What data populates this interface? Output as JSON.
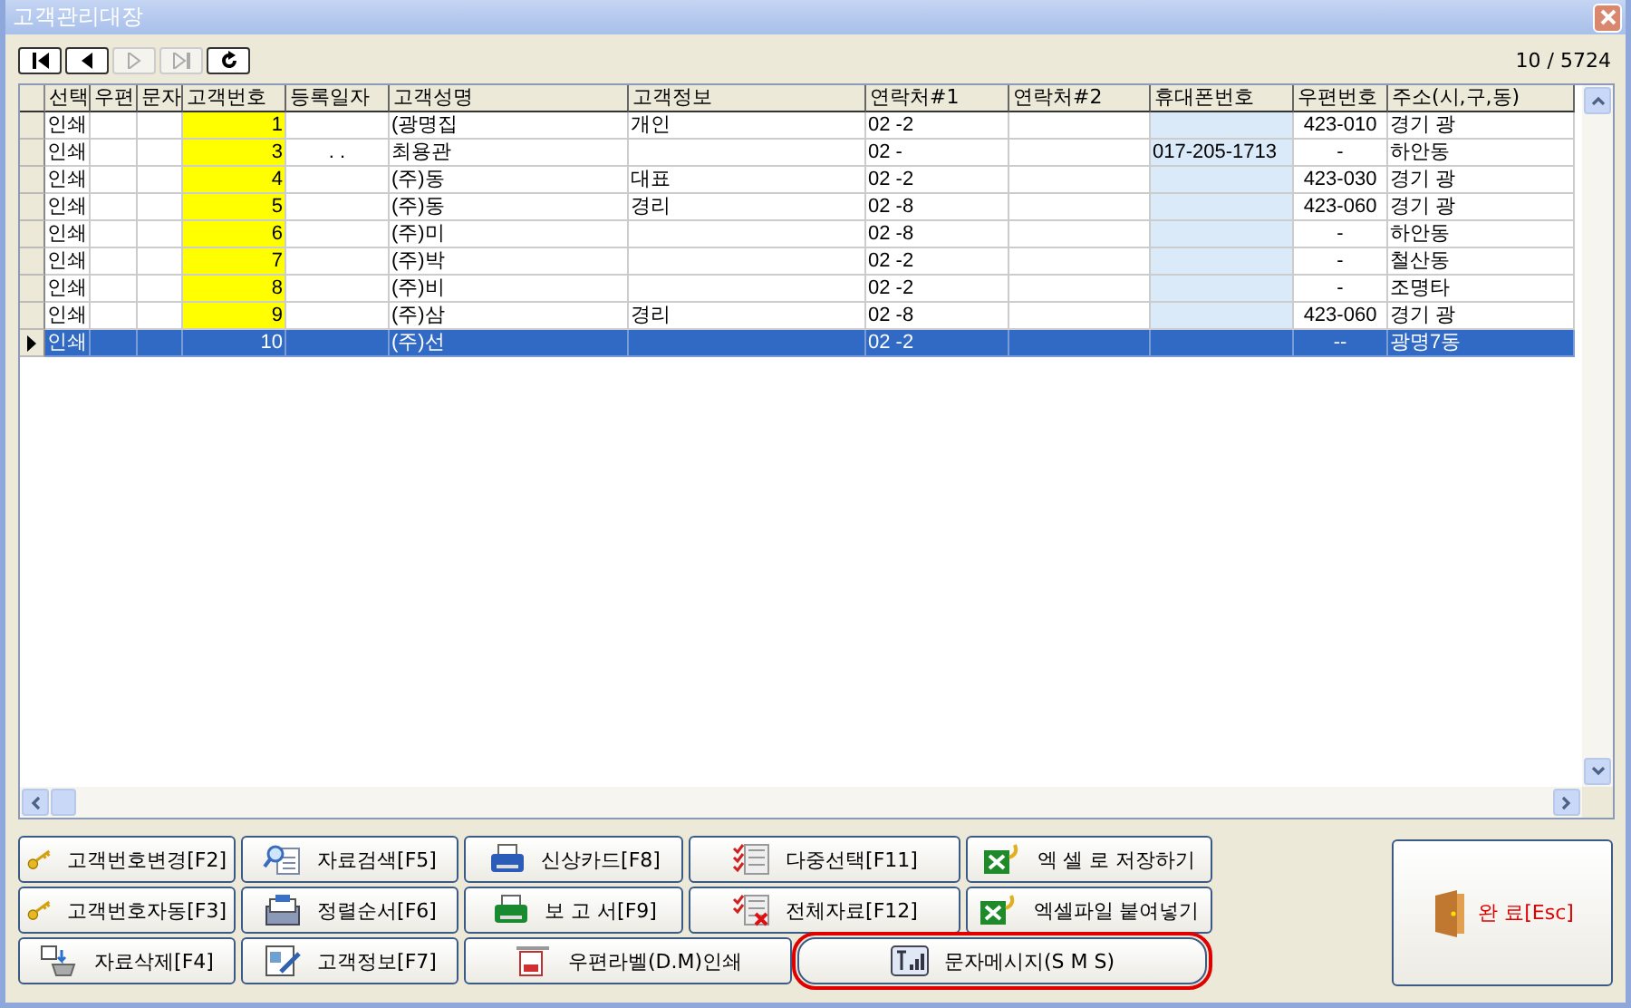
{
  "window": {
    "title": "고객관리대장"
  },
  "nav_buttons": [
    {
      "kind": "first",
      "disabled": false
    },
    {
      "kind": "prev",
      "disabled": false
    },
    {
      "kind": "next",
      "disabled": true
    },
    {
      "kind": "last",
      "disabled": true
    },
    {
      "kind": "refresh",
      "disabled": false
    }
  ],
  "record_counter": "10 / 5724",
  "table": {
    "columns": [
      {
        "label": "선택"
      },
      {
        "label": "우편"
      },
      {
        "label": "문자"
      },
      {
        "label": "고객번호",
        "color": "#ffff00"
      },
      {
        "label": "등록일자"
      },
      {
        "label": "고객성명"
      },
      {
        "label": "고객정보"
      },
      {
        "label": "연락처#1"
      },
      {
        "label": "연락처#2"
      },
      {
        "label": "휴대폰번호",
        "color": "#daeaf8"
      },
      {
        "label": "우편번호"
      },
      {
        "label": "주소(시,구,동)"
      }
    ],
    "rows": [
      {
        "selected": false,
        "cells": [
          "인쇄",
          null,
          null,
          "1",
          null,
          "(광명집",
          "개인",
          "02   -2",
          null,
          null,
          "423-010",
          "경기 광"
        ]
      },
      {
        "selected": false,
        "cells": [
          "인쇄",
          null,
          null,
          "3",
          ".   .",
          "최용관",
          null,
          "02   -",
          null,
          "017-205-1713",
          "-",
          "하안동"
        ]
      },
      {
        "selected": false,
        "cells": [
          "인쇄",
          null,
          null,
          "4",
          null,
          "(주)동",
          "대표",
          "02   -2",
          null,
          null,
          "423-030",
          "경기 광"
        ]
      },
      {
        "selected": false,
        "cells": [
          "인쇄",
          null,
          null,
          "5",
          null,
          "(주)동",
          "경리",
          "02   -8",
          null,
          null,
          "423-060",
          "경기 광"
        ]
      },
      {
        "selected": false,
        "cells": [
          "인쇄",
          null,
          null,
          "6",
          null,
          "(주)미",
          null,
          "02   -8",
          null,
          null,
          "-",
          "하안동"
        ]
      },
      {
        "selected": false,
        "cells": [
          "인쇄",
          null,
          null,
          "7",
          null,
          "(주)박",
          null,
          "02   -2",
          null,
          null,
          "-",
          "철산동"
        ]
      },
      {
        "selected": false,
        "cells": [
          "인쇄",
          null,
          null,
          "8",
          null,
          "(주)비",
          null,
          "02   -2",
          null,
          null,
          "-",
          "조명타"
        ]
      },
      {
        "selected": false,
        "cells": [
          "인쇄",
          null,
          null,
          "9",
          null,
          "(주)삼",
          "경리",
          "02   -8",
          null,
          null,
          "423-060",
          "경기 광"
        ]
      },
      {
        "selected": true,
        "cells": [
          "인쇄",
          null,
          null,
          "10",
          null,
          "(주)선",
          null,
          "02   -2",
          null,
          null,
          "--",
          "광명7동"
        ]
      }
    ]
  },
  "action_buttons": [
    [
      {
        "label": "고객번호변경[F2]"
      },
      {
        "label": "자료검색[F5]"
      },
      {
        "label": "신상카드[F8]"
      },
      {
        "label": "다중선택[F11]"
      },
      {
        "label": "엑 셀 로 저장하기"
      }
    ],
    [
      {
        "label": "고객번호자동[F3]"
      },
      {
        "label": "정렬순서[F6]"
      },
      {
        "label": "보 고 서[F9]"
      },
      {
        "label": "전체자료[F12]"
      },
      {
        "label": "엑셀파일 붙여넣기"
      }
    ],
    [
      {
        "label": "자료삭제[F4]",
        "circled": false
      },
      {
        "label": "고객정보[F7]",
        "circled": false
      },
      {
        "label": "우편라벨(D.M)인쇄",
        "circled": false
      },
      {
        "label": "문자메시지(S M S)",
        "circled": true
      }
    ]
  ],
  "exit_button": {
    "label": "완 료[Esc]"
  }
}
